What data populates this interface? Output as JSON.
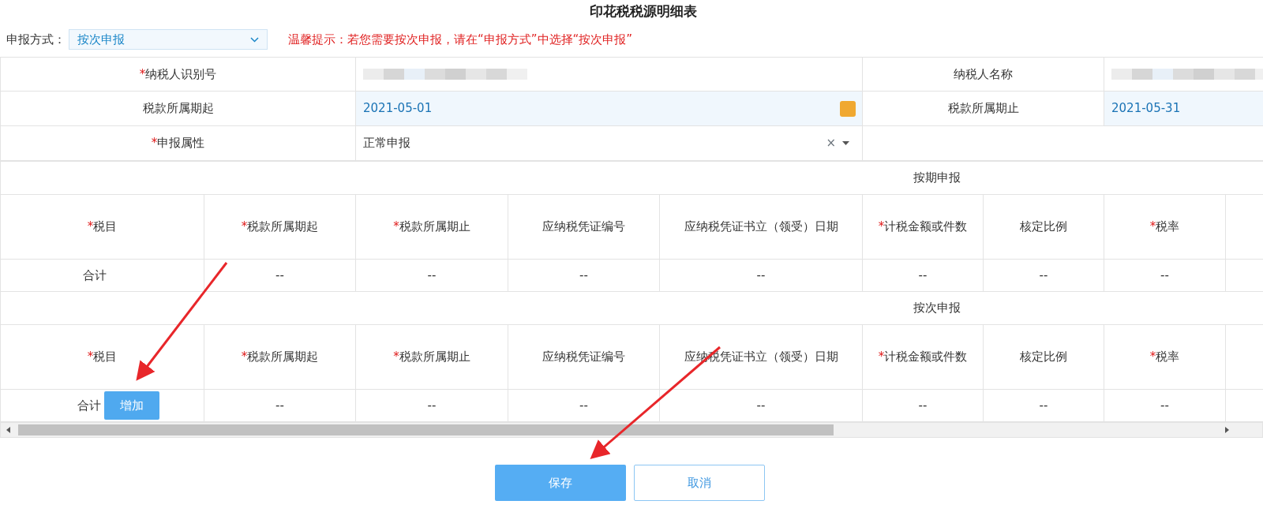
{
  "title": "印花税税源明细表",
  "filing_mode": {
    "label": "申报方式：",
    "value": "按次申报"
  },
  "notice": "温馨提示：若您需要按次申报，请在“申报方式”中选择“按次申报”",
  "form_rows": [
    [
      {
        "label": "纳税人识别号",
        "required_mark": "*",
        "kind": "redacted"
      },
      {
        "label": "纳税人名称",
        "kind": "redacted"
      }
    ],
    [
      {
        "label": "税款所属期起",
        "kind": "date",
        "value": "2021-05-01",
        "calendar": true
      },
      {
        "label": "税款所属期止",
        "kind": "date",
        "value": "2021-05-31"
      }
    ],
    [
      {
        "label": "申报属性",
        "required_mark": "*",
        "kind": "select",
        "value": "正常申报",
        "clear": "×"
      }
    ]
  ],
  "sections": [
    {
      "title": "按期申报",
      "columns": [
        {
          "label": "税目",
          "required_mark": "*"
        },
        {
          "label": "税款所属期起",
          "required_mark": "*"
        },
        {
          "label": "税款所属期止",
          "required_mark": "*"
        },
        {
          "label": "应纳税凭证编号"
        },
        {
          "label": "应纳税凭证书立（领受）日期"
        },
        {
          "label": "计税金额或件数",
          "required_mark": "*"
        },
        {
          "label": "核定比例"
        },
        {
          "label": "税率",
          "required_mark": "*"
        }
      ],
      "total": {
        "label": "合计",
        "cells": [
          "--",
          "--",
          "--",
          "--",
          "--",
          "--",
          "--"
        ]
      }
    },
    {
      "title": "按次申报",
      "columns": [
        {
          "label": "税目",
          "required_mark": "*"
        },
        {
          "label": "税款所属期起",
          "required_mark": "*"
        },
        {
          "label": "税款所属期止",
          "required_mark": "*"
        },
        {
          "label": "应纳税凭证编号"
        },
        {
          "label": "应纳税凭证书立（领受）日期"
        },
        {
          "label": "计税金额或件数",
          "required_mark": "*"
        },
        {
          "label": "核定比例"
        },
        {
          "label": "税率",
          "required_mark": "*"
        }
      ],
      "total": {
        "label": "合计",
        "add_button": "增加",
        "cells": [
          "--",
          "--",
          "--",
          "--",
          "--",
          "--",
          "--"
        ]
      }
    }
  ],
  "buttons": [
    {
      "label": "保存",
      "kind": "primary"
    },
    {
      "label": "取消",
      "kind": "outline"
    }
  ]
}
